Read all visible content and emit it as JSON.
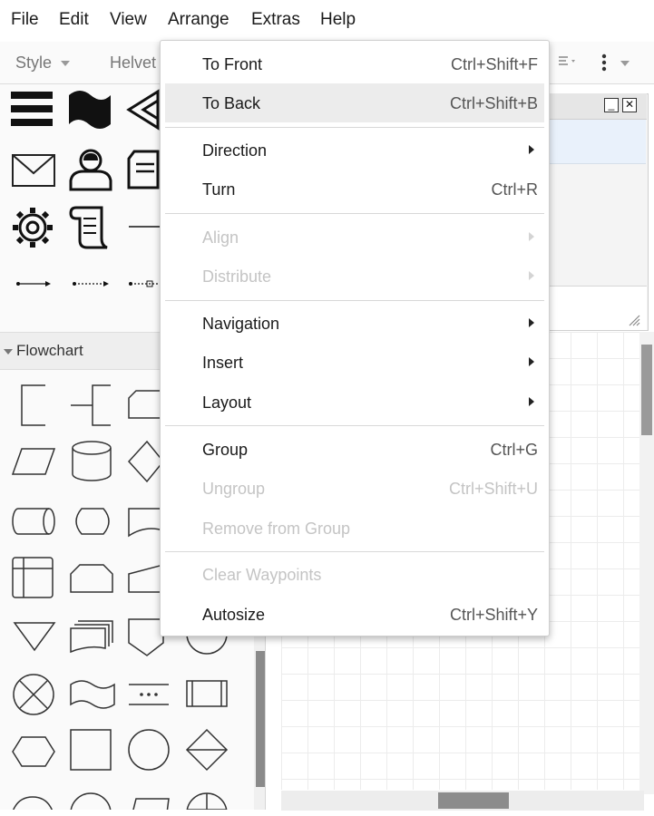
{
  "menubar": {
    "items": [
      "File",
      "Edit",
      "View",
      "Arrange",
      "Extras",
      "Help"
    ]
  },
  "toolbar": {
    "style_label": "Style",
    "font_label": "Helvet"
  },
  "sidebar": {
    "section_title": "Flowchart"
  },
  "format_panel": {
    "minimize_glyph": "_",
    "close_glyph": "✕"
  },
  "arrange_menu": {
    "items": [
      {
        "label": "To Front",
        "shortcut": "Ctrl+Shift+F",
        "enabled": true
      },
      {
        "label": "To Back",
        "shortcut": "Ctrl+Shift+B",
        "enabled": true,
        "highlighted": true
      },
      {
        "label": "Direction",
        "submenu": true,
        "enabled": true
      },
      {
        "label": "Turn",
        "shortcut": "Ctrl+R",
        "enabled": true
      },
      {
        "label": "Align",
        "submenu": true,
        "enabled": false
      },
      {
        "label": "Distribute",
        "submenu": true,
        "enabled": false
      },
      {
        "label": "Navigation",
        "submenu": true,
        "enabled": true
      },
      {
        "label": "Insert",
        "submenu": true,
        "enabled": true
      },
      {
        "label": "Layout",
        "submenu": true,
        "enabled": true
      },
      {
        "label": "Group",
        "shortcut": "Ctrl+G",
        "enabled": true
      },
      {
        "label": "Ungroup",
        "shortcut": "Ctrl+Shift+U",
        "enabled": false
      },
      {
        "label": "Remove from Group",
        "enabled": false
      },
      {
        "label": "Clear Waypoints",
        "enabled": false
      },
      {
        "label": "Autosize",
        "shortcut": "Ctrl+Shift+Y",
        "enabled": true
      }
    ]
  }
}
